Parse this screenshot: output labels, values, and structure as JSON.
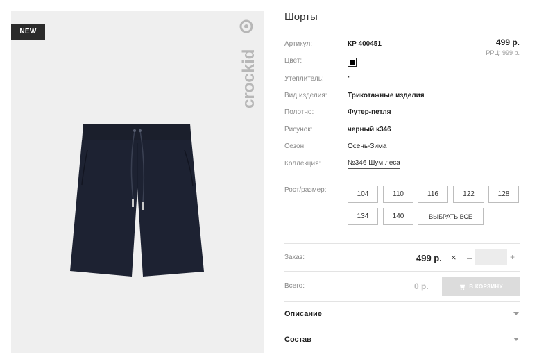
{
  "image": {
    "badge": "NEW",
    "brand": "crockid",
    "logo_icon": "crockid-logo-icon",
    "product_icon": "shorts-image"
  },
  "product": {
    "title": "Шорты",
    "price": "499 р.",
    "rrc": "РРЦ: 999 р.",
    "attributes": [
      {
        "label": "Артикул:",
        "value": "КР 400451"
      },
      {
        "label": "Цвет:",
        "value": ""
      },
      {
        "label": "Утеплитель:",
        "value": "\""
      },
      {
        "label": "Вид изделия:",
        "value": "Трикотажные изделия"
      },
      {
        "label": "Полотно:",
        "value": "Футер-петля"
      },
      {
        "label": "Рисунок:",
        "value": "черный к346"
      },
      {
        "label": "Сезон:",
        "value": "Осень-Зима"
      },
      {
        "label": "Коллекция:",
        "value": "№346 Шум леса"
      }
    ],
    "color_value": "#000000"
  },
  "sizes": {
    "label": "Рост/размер:",
    "options": [
      "104",
      "110",
      "116",
      "122",
      "128",
      "134",
      "140"
    ],
    "select_all": "ВЫБРАТЬ ВСЕ"
  },
  "order": {
    "label": "Заказ:",
    "price": "499 р.",
    "times": "×",
    "minus": "–",
    "plus": "+",
    "quantity": ""
  },
  "total": {
    "label": "Всего:",
    "value": "0 р.",
    "cart_button": "В КОРЗИНУ"
  },
  "accordion": [
    {
      "title": "Описание"
    },
    {
      "title": "Состав"
    }
  ],
  "colors": {
    "panel_bg": "#efefef",
    "badge_bg": "#2b2b2b",
    "cart_disabled": "#dcdcdc"
  }
}
